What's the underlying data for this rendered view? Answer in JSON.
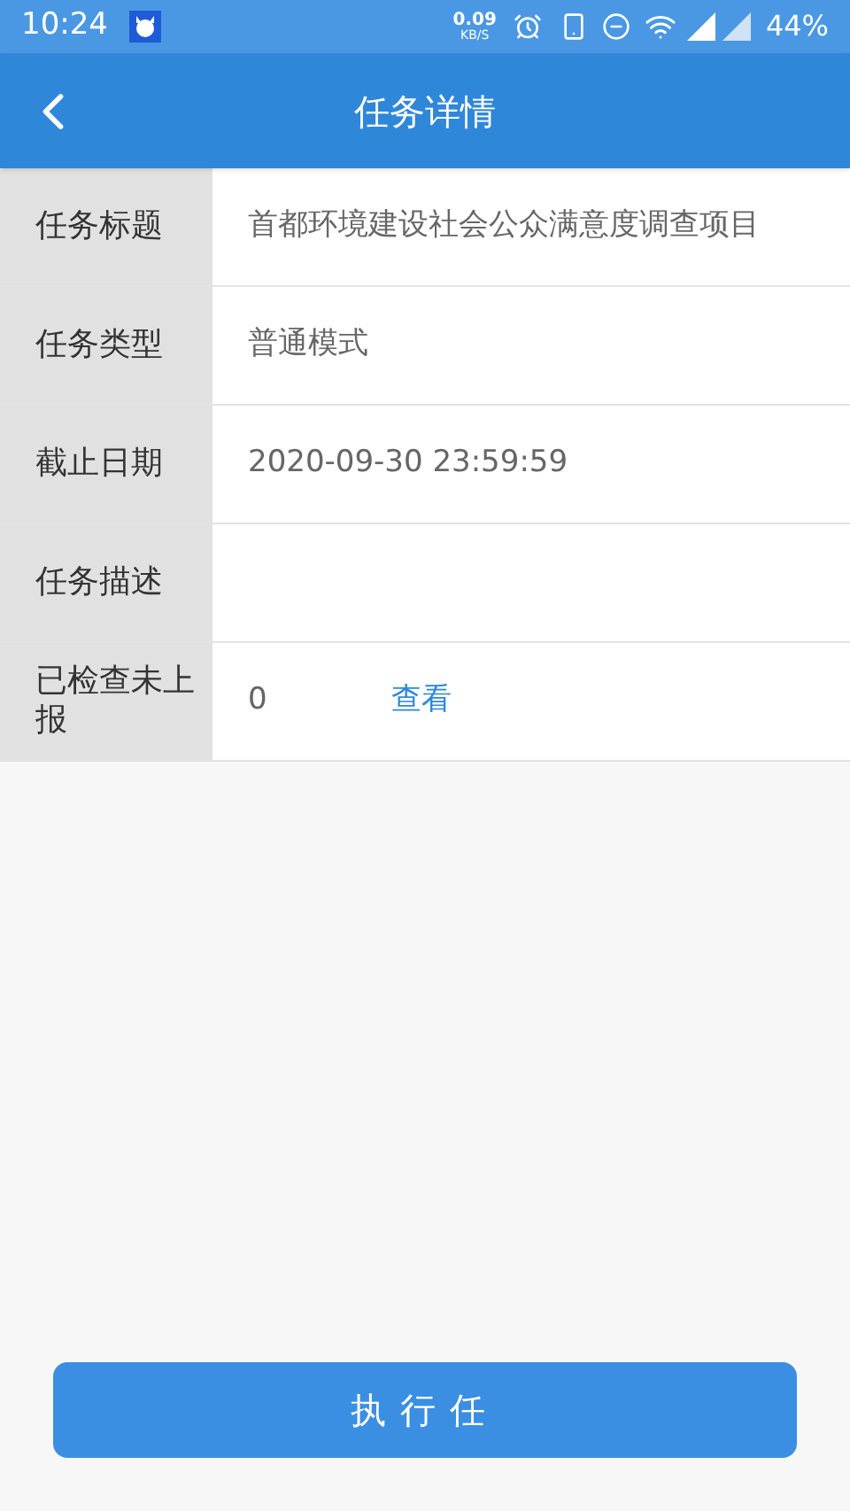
{
  "status_bar": {
    "time": "10:24",
    "speed_value": "0.09",
    "speed_unit": "KB/S",
    "battery": "44%"
  },
  "header": {
    "title": "任务详情"
  },
  "rows": [
    {
      "kind": "text",
      "label": "任务标题",
      "value": "首都环境建设社会公众满意度调查项目"
    },
    {
      "kind": "text",
      "label": "任务类型",
      "value": "普通模式"
    },
    {
      "kind": "text",
      "label": "截止日期",
      "value": "2020-09-30 23:59:59"
    },
    {
      "kind": "text",
      "label": "任务描述"
    },
    {
      "kind": "link",
      "label": "已检查未上报",
      "value": "0",
      "link": "查看"
    }
  ],
  "action_button": "执行任"
}
